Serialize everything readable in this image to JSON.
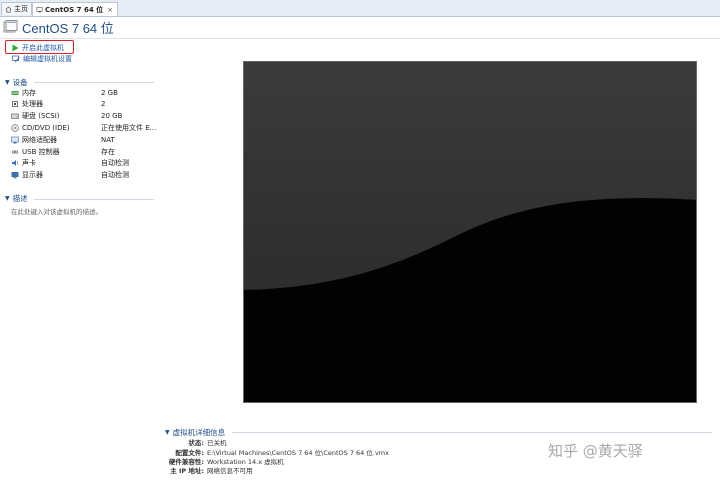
{
  "tabs": [
    {
      "label": "主页",
      "icon": "home-icon"
    },
    {
      "label": "CentOS 7 64 位",
      "icon": "vm-icon",
      "close": "×"
    }
  ],
  "title": "CentOS 7 64 位",
  "actions": {
    "power_on": "开启此虚拟机",
    "edit_settings": "编辑虚拟机设置"
  },
  "devices_section": {
    "title": "设备",
    "items": [
      {
        "name": "内存",
        "value": "2 GB",
        "icon": "memory-icon"
      },
      {
        "name": "处理器",
        "value": "2",
        "icon": "cpu-icon"
      },
      {
        "name": "硬盘 (SCSI)",
        "value": "20 GB",
        "icon": "disk-icon"
      },
      {
        "name": "CD/DVD (IDE)",
        "value": "正在使用文件 E...",
        "icon": "cd-icon"
      },
      {
        "name": "网络适配器",
        "value": "NAT",
        "icon": "network-icon"
      },
      {
        "name": "USB 控制器",
        "value": "存在",
        "icon": "usb-icon"
      },
      {
        "name": "声卡",
        "value": "自动检测",
        "icon": "sound-icon"
      },
      {
        "name": "显示器",
        "value": "自动检测",
        "icon": "display-icon"
      }
    ]
  },
  "description_section": {
    "title": "描述",
    "placeholder": "在此处键入对该虚拟机的描述。"
  },
  "details": {
    "title": "虚拟机详细信息",
    "rows": [
      {
        "key": "状态:",
        "value": "已关机"
      },
      {
        "key": "配置文件:",
        "value": "E:\\Virtual Machines\\CentOS 7 64 位\\CentOS 7 64 位.vmx"
      },
      {
        "key": "硬件兼容性:",
        "value": "Workstation 14.x 虚拟机"
      },
      {
        "key": "主 IP 地址:",
        "value": "网络信息不可用"
      }
    ]
  },
  "watermark": "知乎 @黄天驿",
  "colors": {
    "accent": "#1f4e8c",
    "link": "#1f56b0",
    "highlight": "#e02020",
    "play": "#2faa2f"
  }
}
